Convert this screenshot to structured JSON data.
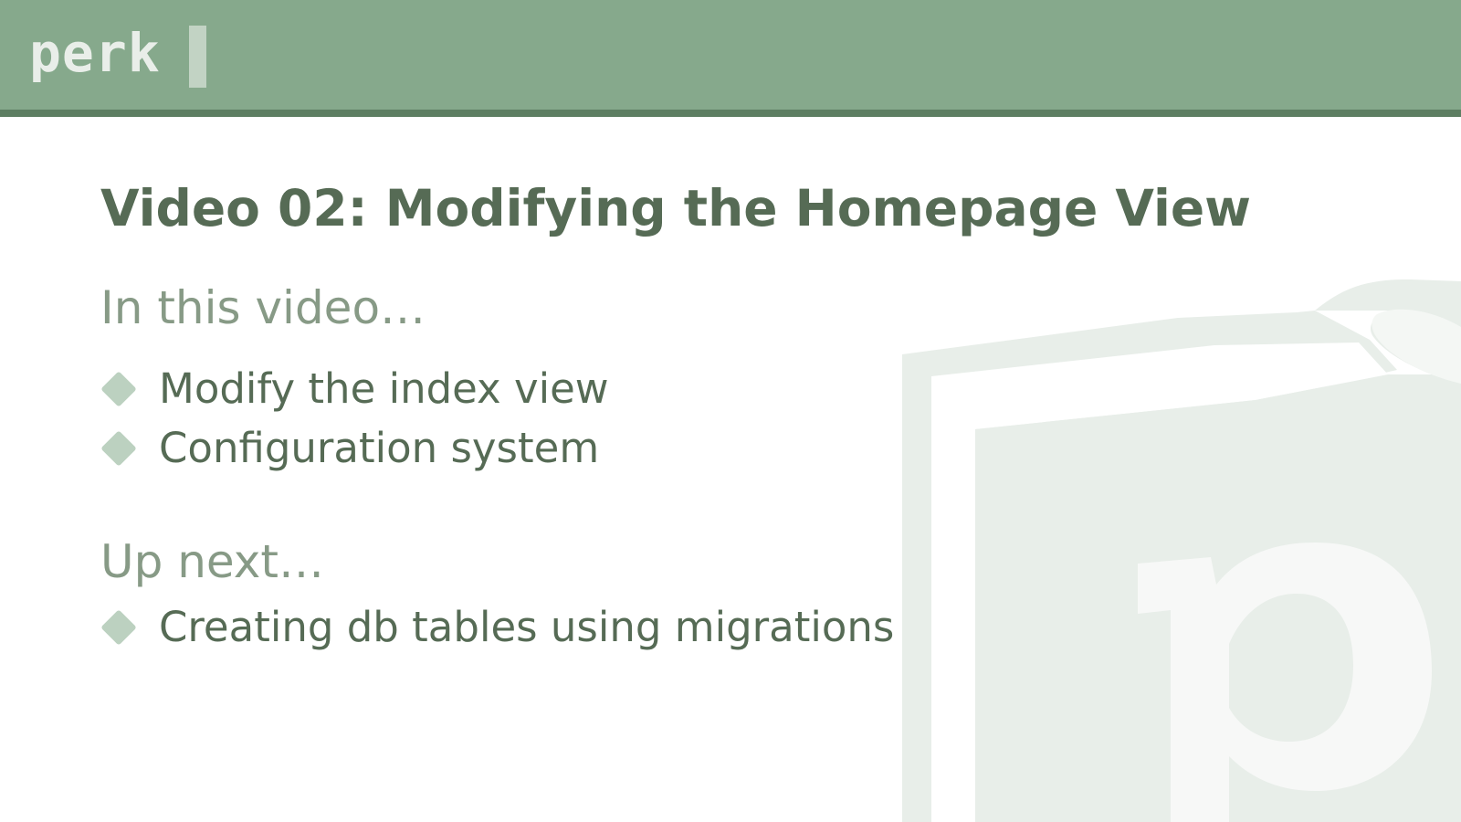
{
  "header": {
    "logo_text": "perk"
  },
  "title": "Video 02: Modifying the Homepage View",
  "sections": [
    {
      "heading": "In this video…",
      "items": [
        "Modify the index view",
        "Configuration system"
      ]
    },
    {
      "heading": "Up next…",
      "items": [
        "Creating db tables using migrations"
      ]
    }
  ],
  "watermark": {
    "icon": "perk-book-logo-icon",
    "letter": "p"
  },
  "colors": {
    "header_bg": "#86a98c",
    "header_border": "#5d7e62",
    "title_text": "#566b55",
    "heading_text": "#879a86",
    "bullet": "#bcd1c0",
    "watermark": "#e8eee9"
  }
}
